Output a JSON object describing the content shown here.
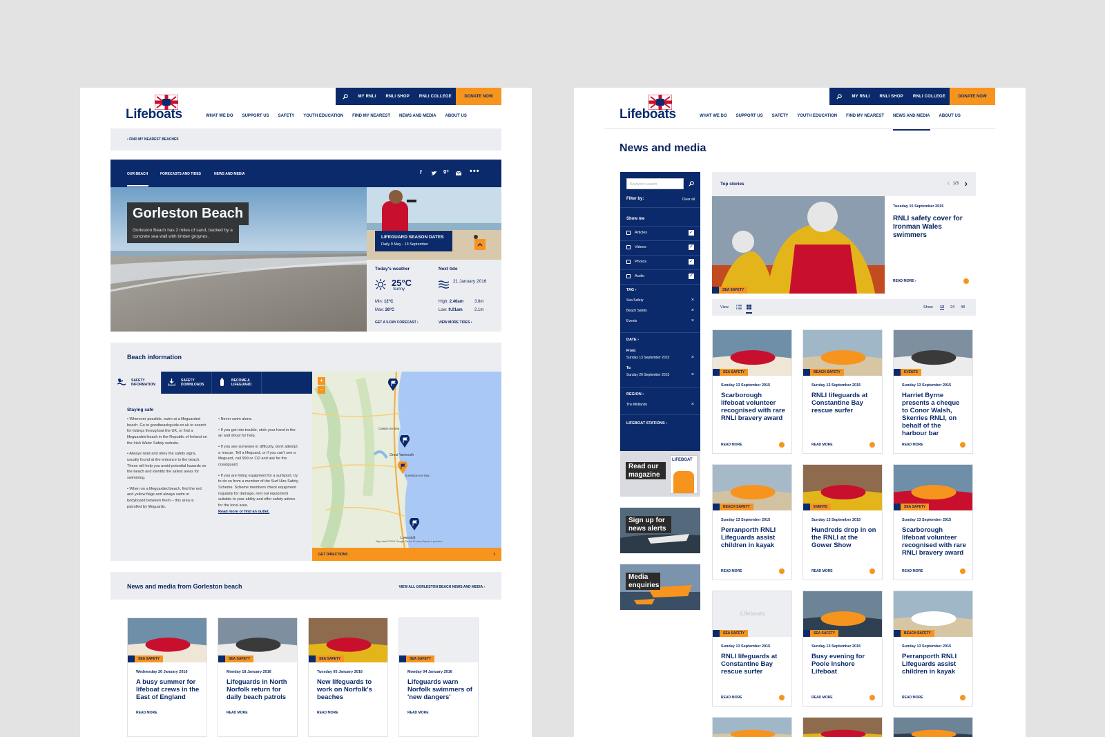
{
  "header": {
    "logo_text": "Lifeboats",
    "top_links": [
      "MY RNLI",
      "RNLI SHOP",
      "RNLI COLLEGE"
    ],
    "donate": "DONATE NOW",
    "nav": [
      "WHAT WE DO",
      "SUPPORT US",
      "SAFETY",
      "YOUTH EDUCATION",
      "FIND MY NEAREST",
      "NEWS AND MEDIA",
      "ABOUT US"
    ]
  },
  "left": {
    "breadcrumb": "FIND MY NEAREST BEACHES",
    "tabs": [
      "OUR BEACH",
      "FORECASTS AND TIDES",
      "NEWS AND MEDIA"
    ],
    "hero_title": "Gorleston Beach",
    "hero_desc": "Gorleston Beach has 2 miles of sand, backed by a concrete sea wall with timber groynes.",
    "lifeguard": {
      "title": "LIFEGUARD SEASON DATES",
      "dates": "Daily  9 May - 13 September"
    },
    "weather": {
      "heading": "Today's weather",
      "temp": "25°C",
      "desc": "Sunny",
      "min_label": "Min:",
      "min": "12°C",
      "max_label": "Max:",
      "max": "26°C",
      "link": "GET A 5-DAY FORECAST"
    },
    "tide": {
      "heading": "Next tide",
      "date": "21 January 2016",
      "high_label": "High:",
      "high_time": "2.46am",
      "high_height": "3.8m",
      "low_label": "Low:",
      "low_time": "9.01am",
      "low_height": "2.1m",
      "link": "VIEW MORE TIDES"
    },
    "beach_info": {
      "heading": "Beach information",
      "tabs": [
        "SAFETY INFORMATION",
        "SAFETY DOWNLOADS",
        "BECOME A LIFEGUARD"
      ],
      "subheading": "Staying safe",
      "col1": [
        "• Wherever possible, swim at a lifeguarded beach. Go to goodbeachguide.co.uk to search for listings throughout the UK, or find a lifeguarded beach in the Republic of Ireland on the Irish Water Safety website.",
        "• Always read and obey the safety signs, usually found at the entrance to the beach. These will help you avoid potential hazards on the beach and identify the safest areas for swimming.",
        "• When on a lifeguarded beach, find the red and yellow flags and always swim or bodyboard between them – this area is patrolled by lifeguards."
      ],
      "col2": [
        "• Never swim alone.",
        "• If you get into trouble, stick your hand in the air and shout for help.",
        "• If you see someone in difficulty, don't attempt a rescue. Tell a lifeguard, or if you can't see a lifeguard, call 999 or 112 and ask for the coastguard.",
        "• If you are hiring equipment for a surfsport, try to do so from a member of the Surf Hire Safety Scheme. Scheme members check equipment regularly for damage, rent out equipment suitable to your ability and offer safety advice for the local area."
      ],
      "more_link": "Read more or find an outlet.",
      "directions": "GET DIRECTIONS",
      "map_places": [
        "Great Yarmouth",
        "Lowestoft",
        "Gorleston-on-Sea",
        "Caister-on-Sea"
      ],
      "map_footer": "Map data ©2015 Google   Terms   Privacy   Report a problem"
    },
    "news": {
      "heading": "News and media from Gorleston beach",
      "view_all": "VIEW ALL GORLESTON BEACH NEWS AND MEDIA",
      "items": [
        {
          "tag": "SEA SAFETY",
          "date": "Wednesday 20 January 2016",
          "title": "A busy summer for lifeboat crews in the East of England",
          "more": "READ MORE"
        },
        {
          "tag": "SEA SAFETY",
          "date": "Monday 18 January 2016",
          "title": "Lifeguards in North Norfolk return for daily beach patrols",
          "more": "READ MORE"
        },
        {
          "tag": "SEA SAFETY",
          "date": "Tuesday 05 January 2016",
          "title": "New lifeguards to work on Norfolk's beaches",
          "more": "READ MORE"
        },
        {
          "tag": "SEA SAFETY",
          "date": "Monday 04 January 2016",
          "title": "Lifeguards warn Norfolk swimmers of 'new dangers'",
          "more": "READ MORE"
        }
      ]
    }
  },
  "right": {
    "page_title": "News and media",
    "filter": {
      "search_placeholder": "Keyword search",
      "filter_by": "Filter by:",
      "clear_all": "Clear all",
      "show_me": "Show me",
      "types": [
        "Articles",
        "Videos",
        "Photos",
        "Audio"
      ],
      "tag_label": "TAG",
      "tags": [
        "Sea Safety",
        "Beach Safety",
        "Events"
      ],
      "date_label": "DATE",
      "from_label": "From:",
      "from": "Sunday 13 September 2015",
      "to_label": "To:",
      "to": "Sunday 20 September 2015",
      "region_label": "REGION",
      "region": "The Midlands",
      "stations_label": "LIFEBOAT STATIONS"
    },
    "promos": [
      "Read our magazine",
      "Sign up for news alerts",
      "Media enquiries"
    ],
    "magazine_cover": "LIFEBOAT",
    "top_stories": {
      "label": "Top stories",
      "pager": "1/3",
      "tag": "SEA SAFETY",
      "date": "Tuesday 15 September 2015",
      "title": "RNLI safety cover for Ironman Wales swimmers",
      "more": "READ MORE"
    },
    "view_bar": {
      "view_label": "View",
      "show_label": "Show",
      "options": [
        "12",
        "24",
        "48"
      ]
    },
    "grid": [
      {
        "tag": "SEA SAFETY",
        "date": "Sunday 13 September 2015",
        "title": "Scarborough lifeboat volunteer recognised with rare RNLI bravery award",
        "more": "READ MORE"
      },
      {
        "tag": "BEACH SAFETY",
        "date": "Sunday 13 September 2015",
        "title": "RNLI lifeguards at Constantine Bay rescue surfer",
        "more": "READ MORE"
      },
      {
        "tag": "EVENTS",
        "date": "Sunday 13 September 2015",
        "title": "Harriet Byrne presents a cheque to Conor Walsh, Skerries RNLI, on behalf of the harbour bar",
        "more": "READ MORE"
      },
      {
        "tag": "BEACH SAFETY",
        "date": "Sunday 13 September 2015",
        "title": "Perranporth RNLI Lifeguards assist children in kayak",
        "more": "READ MORE"
      },
      {
        "tag": "EVENTS",
        "date": "Sunday 13 September 2015",
        "title": "Hundreds drop in on the RNLI at the Gower Show",
        "more": "READ MORE"
      },
      {
        "tag": "SEA SAFETY",
        "date": "Sunday 13 September 2015",
        "title": "Scarborough lifeboat volunteer recognised with rare RNLI bravery award",
        "more": "READ MORE"
      },
      {
        "tag": "SEA SAFETY",
        "date": "Sunday 13 September 2015",
        "title": "RNLI lifeguards at Constantine Bay rescue surfer",
        "more": "READ MORE"
      },
      {
        "tag": "SEA SAFETY",
        "date": "Sunday 13 September 2015",
        "title": "Busy evening for Poole Inshore Lifeboat",
        "more": "READ MORE"
      },
      {
        "tag": "BEACH SAFETY",
        "date": "Sunday 13 September 2015",
        "title": "Perranporth RNLI Lifeguards assist children in kayak",
        "more": "READ MORE"
      }
    ],
    "placeholder_logo": "Lifeboats"
  },
  "colors": {
    "navy": "#0b2a6b",
    "orange": "#f7941d",
    "gray_panel": "#ecedf0",
    "page_bg": "#e3e3e3"
  }
}
